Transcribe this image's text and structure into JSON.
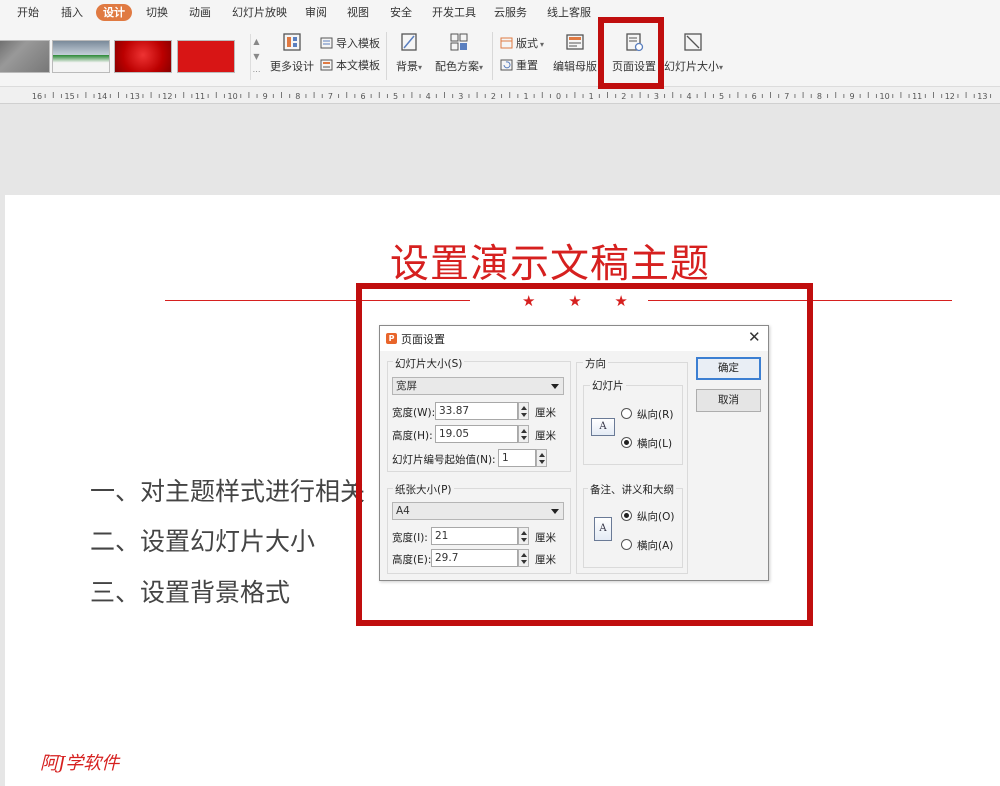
{
  "menu": {
    "tabs": [
      "开始",
      "插入",
      "设计",
      "切换",
      "动画",
      "幻灯片放映",
      "审阅",
      "视图",
      "安全",
      "开发工具",
      "云服务",
      "线上客服"
    ],
    "active_tab": "设计"
  },
  "ribbon": {
    "more_design": "更多设计",
    "import_template": "导入模板",
    "text_template": "本文模板",
    "background": "背景",
    "color_scheme": "配色方案",
    "layout": "版式",
    "reset": "重置",
    "edit_master": "编辑母版",
    "page_setup": "页面设置",
    "slide_size": "幻灯片大小"
  },
  "ruler": {
    "labels": [
      "16",
      "15",
      "14",
      "13",
      "12",
      "11",
      "10",
      "9",
      "8",
      "7",
      "6",
      "5",
      "4",
      "3",
      "2",
      "1",
      "0",
      "1",
      "2",
      "3",
      "4",
      "5",
      "6",
      "7",
      "8",
      "9",
      "10",
      "11",
      "12",
      "13"
    ]
  },
  "slide": {
    "title": "设置演示文稿主题",
    "stars": "★ ★ ★",
    "bullets": [
      "一、对主题样式进行相关",
      "二、设置幻灯片大小",
      "三、设置背景格式"
    ],
    "watermark": "阿J学软件"
  },
  "dialog": {
    "title": "页面设置",
    "close": "✕",
    "slide_size_group": "幻灯片大小(S)",
    "slide_size_value": "宽屏",
    "width_label": "宽度(W):",
    "width_value": "33.87",
    "height_label": "高度(H):",
    "height_value": "19.05",
    "unit": "厘米",
    "start_number_label": "幻灯片编号起始值(N):",
    "start_number_value": "1",
    "paper_group": "纸张大小(P)",
    "paper_value": "A4",
    "paper_width_label": "宽度(I):",
    "paper_width_value": "21",
    "paper_height_label": "高度(E):",
    "paper_height_value": "29.7",
    "orientation_group": "方向",
    "slides_group": "幻灯片",
    "portrait_r": "纵向(R)",
    "landscape_l": "横向(L)",
    "notes_group": "备注、讲义和大纲",
    "portrait_o": "纵向(O)",
    "landscape_a": "横向(A)",
    "page_icon_glyph": "A",
    "ok": "确定",
    "cancel": "取消"
  },
  "colors": {
    "accent": "#d6201f",
    "highlight": "#c00e0e",
    "active_tab": "#e07a42"
  }
}
